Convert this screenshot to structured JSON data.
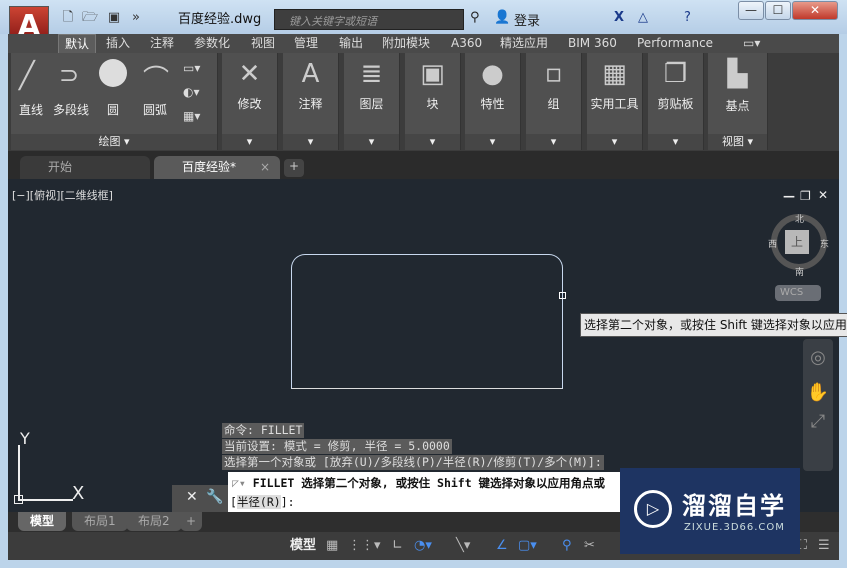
{
  "app": {
    "logo": "A",
    "document_title": "百度经验.dwg",
    "search_placeholder": "键入关键字或短语",
    "login": "登录"
  },
  "window_controls": [
    "—",
    "☐",
    "✕"
  ],
  "ribbon_tabs": [
    "默认",
    "插入",
    "注释",
    "参数化",
    "视图",
    "管理",
    "输出",
    "附加模块",
    "A360",
    "精选应用",
    "BIM 360",
    "Performance"
  ],
  "draw_panel": {
    "items": [
      "直线",
      "多段线",
      "圆",
      "圆弧"
    ],
    "footer": "绘图 ▾"
  },
  "panels": [
    {
      "label": "修改",
      "icon": "modify-icon",
      "glyph": "✕"
    },
    {
      "label": "注释",
      "icon": "annotate-icon",
      "glyph": "A"
    },
    {
      "label": "图层",
      "icon": "layers-icon",
      "glyph": "≣"
    },
    {
      "label": "块",
      "icon": "block-icon",
      "glyph": "▣"
    },
    {
      "label": "特性",
      "icon": "properties-icon",
      "glyph": "●"
    },
    {
      "label": "组",
      "icon": "group-icon",
      "glyph": "▫"
    },
    {
      "label": "实用工具",
      "icon": "calculator-icon",
      "glyph": "▦"
    },
    {
      "label": "剪贴板",
      "icon": "clipboard-icon",
      "glyph": "❐"
    }
  ],
  "view_panel": {
    "label": "基点",
    "footer": "视图 ▾"
  },
  "file_tabs": [
    "开始",
    "百度经验*"
  ],
  "viewport": {
    "label": "[−][俯视][二维线框]",
    "tooltip": "选择第二个对象，或按住 Shift 键选择对象以应用角点",
    "viewcube": {
      "top": "上",
      "north": "北",
      "south": "南",
      "east": "东",
      "west": "西",
      "wcs": "WCS"
    }
  },
  "ucs": {
    "x": "X",
    "y": "Y"
  },
  "command_history": [
    "命令:  FILLET",
    "当前设置: 模式 = 修剪, 半径 = 5.0000",
    "选择第一个对象或 [放弃(U)/多段线(P)/半径(R)/修剪(T)/多个(M)]:"
  ],
  "command_line": {
    "line1": "FILLET 选择第二个对象, 或按住 Shift 键选择对象以应用角点或",
    "line2_prefix": "[",
    "option": "半径(R)",
    "line2_suffix": "]:"
  },
  "layout_tabs": [
    "模型",
    "布局1",
    "布局2"
  ],
  "status": {
    "model": "模型"
  },
  "watermark": {
    "title": "溜溜自学",
    "url": "ZIXUE.3D66.COM"
  }
}
